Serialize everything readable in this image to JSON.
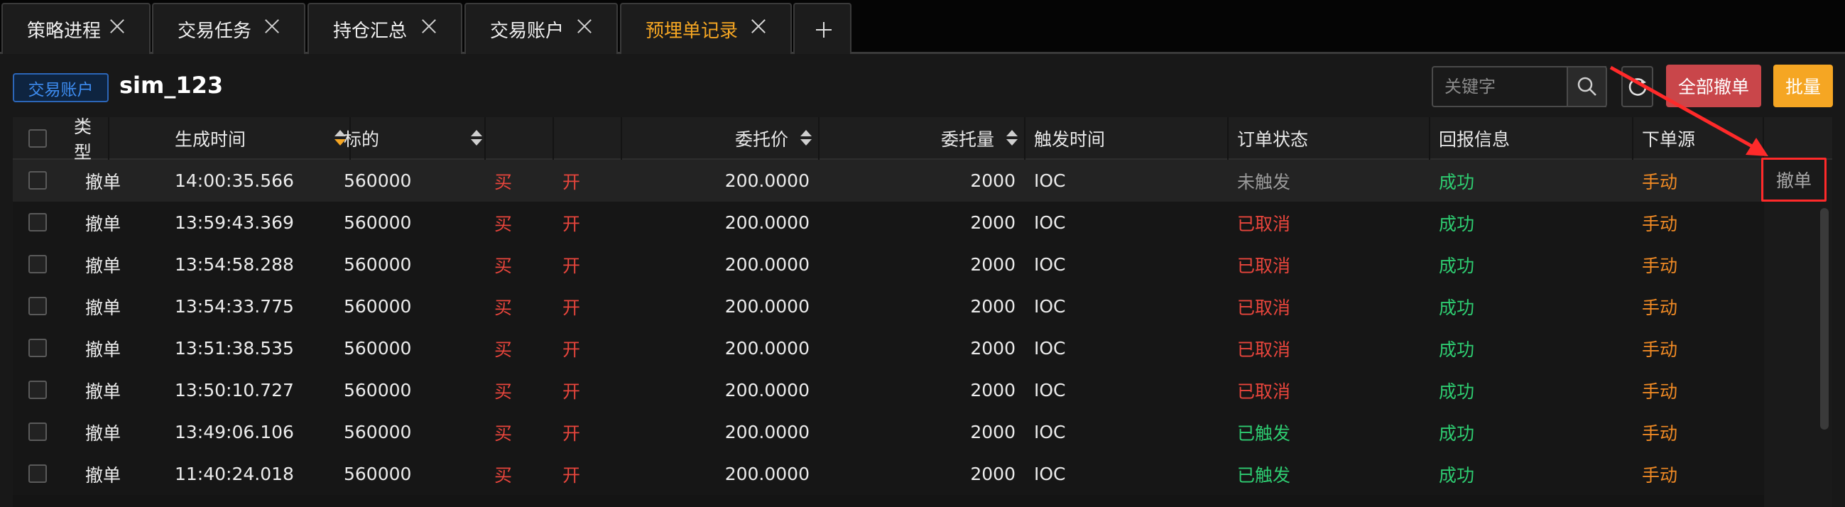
{
  "tabs": [
    {
      "label": "策略进程",
      "active": false
    },
    {
      "label": "交易任务",
      "active": false
    },
    {
      "label": "持仓汇总",
      "active": false
    },
    {
      "label": "交易账户",
      "active": false
    },
    {
      "label": "预埋单记录",
      "active": true
    }
  ],
  "toolbar": {
    "account_badge": "交易账户",
    "account_name": "sim_123",
    "search_placeholder": "关键字",
    "cancel_all_label": "全部撤单",
    "batch_label": "批量"
  },
  "table": {
    "headers": {
      "type": "类型",
      "time": "生成时间",
      "symbol": "标的",
      "price": "委托价",
      "qty": "委托量",
      "trigger_time": "触发时间",
      "status": "订单状态",
      "reply": "回报信息",
      "source": "下单源"
    },
    "rows": [
      {
        "type": "撤单",
        "time": "14:00:35.566",
        "symbol": "560000",
        "side": "买",
        "offset": "开",
        "price": "200.0000",
        "qty": "2000",
        "trigger": "IOC",
        "status": "未触发",
        "reply": "成功",
        "source": "手动",
        "action": "撤单"
      },
      {
        "type": "撤单",
        "time": "13:59:43.369",
        "symbol": "560000",
        "side": "买",
        "offset": "开",
        "price": "200.0000",
        "qty": "2000",
        "trigger": "IOC",
        "status": "已取消",
        "reply": "成功",
        "source": "手动"
      },
      {
        "type": "撤单",
        "time": "13:54:58.288",
        "symbol": "560000",
        "side": "买",
        "offset": "开",
        "price": "200.0000",
        "qty": "2000",
        "trigger": "IOC",
        "status": "已取消",
        "reply": "成功",
        "source": "手动"
      },
      {
        "type": "撤单",
        "time": "13:54:33.775",
        "symbol": "560000",
        "side": "买",
        "offset": "开",
        "price": "200.0000",
        "qty": "2000",
        "trigger": "IOC",
        "status": "已取消",
        "reply": "成功",
        "source": "手动"
      },
      {
        "type": "撤单",
        "time": "13:51:38.535",
        "symbol": "560000",
        "side": "买",
        "offset": "开",
        "price": "200.0000",
        "qty": "2000",
        "trigger": "IOC",
        "status": "已取消",
        "reply": "成功",
        "source": "手动"
      },
      {
        "type": "撤单",
        "time": "13:50:10.727",
        "symbol": "560000",
        "side": "买",
        "offset": "开",
        "price": "200.0000",
        "qty": "2000",
        "trigger": "IOC",
        "status": "已取消",
        "reply": "成功",
        "source": "手动"
      },
      {
        "type": "撤单",
        "time": "13:49:06.106",
        "symbol": "560000",
        "side": "买",
        "offset": "开",
        "price": "200.0000",
        "qty": "2000",
        "trigger": "IOC",
        "status": "已触发",
        "reply": "成功",
        "source": "手动"
      },
      {
        "type": "撤单",
        "time": "11:40:24.018",
        "symbol": "560000",
        "side": "买",
        "offset": "开",
        "price": "200.0000",
        "qty": "2000",
        "trigger": "IOC",
        "status": "已触发",
        "reply": "成功",
        "source": "手动"
      }
    ]
  },
  "colors": {
    "accent": "#f5a623",
    "buy": "#e8453c",
    "cancelled": "#e8453c",
    "triggered": "#2ecc71",
    "success": "#2ecc71",
    "manual": "#f08a24",
    "not_triggered": "#9a9a9a",
    "annotation": "#ff2a2a"
  }
}
